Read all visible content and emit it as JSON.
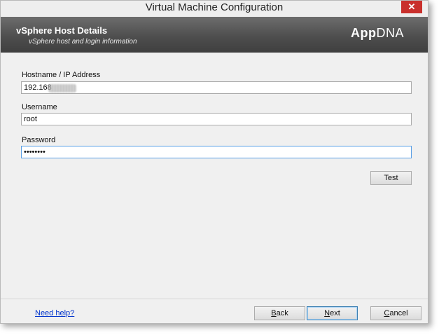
{
  "window": {
    "title": "Virtual Machine Configuration",
    "close_glyph": "✕"
  },
  "banner": {
    "title": "vSphere Host Details",
    "subtitle": "vSphere host and login information",
    "brand_bold": "App",
    "brand_regular": "DNA"
  },
  "form": {
    "hostname": {
      "label": "Hostname / IP Address",
      "value": "192.168"
    },
    "username": {
      "label": "Username",
      "value": "root"
    },
    "password": {
      "label": "Password",
      "value": "••••••••"
    },
    "test_label": "Test"
  },
  "footer": {
    "help_link": "Need help?",
    "back_key": "B",
    "back_rest": "ack",
    "next_key": "N",
    "next_rest": "ext",
    "cancel_key": "C",
    "cancel_rest": "ancel"
  },
  "colors": {
    "close": "#c9302c",
    "banner": "#4e4e4e",
    "link": "#0033cc",
    "focus": "#569de5"
  }
}
